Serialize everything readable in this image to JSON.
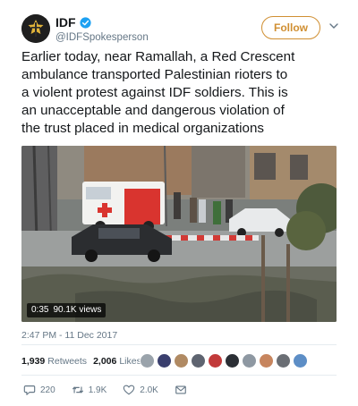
{
  "account": {
    "display_name": "IDF",
    "handle": "@IDFSpokesperson",
    "verified": true,
    "follow_label": "Follow",
    "accent_color": "#d08f32"
  },
  "tweet": {
    "text": "Earlier today, near Ramallah, a Red Crescent\nambulance transported Palestinian rioters to\na violent protest against IDF soldiers. This is\nan unacceptable and dangerous violation of\nthe trust placed in medical organizations"
  },
  "media": {
    "type": "video",
    "duration": "0:35",
    "views": "90.1K views"
  },
  "timestamp": "2:47 PM - 11 Dec 2017",
  "stats": {
    "retweets_count": "1,939",
    "retweets_label": "Retweets",
    "likes_count": "2,006",
    "likes_label": "Likes",
    "liker_avatar_colors": [
      "#9aa3ab",
      "#3a3f6e",
      "#b08a63",
      "#5e6470",
      "#c23a3a",
      "#2b2f35",
      "#8e98a2",
      "#c7855e",
      "#6a6e74",
      "#5d8ec6"
    ]
  },
  "actions": {
    "reply_icon": "reply-icon",
    "reply_count": "220",
    "retweet_icon": "retweet-icon",
    "retweet_count": "1.9K",
    "like_icon": "heart-icon",
    "like_count": "2.0K",
    "dm_icon": "envelope-icon"
  }
}
